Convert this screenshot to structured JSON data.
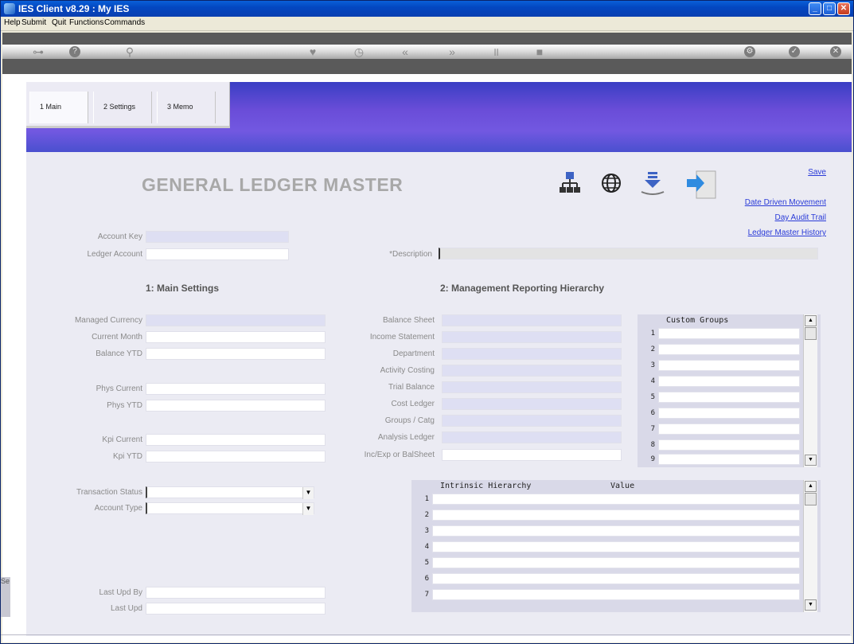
{
  "window": {
    "title": "IES Client v8.29 : My IES",
    "controls": [
      "_",
      "□",
      "✕"
    ]
  },
  "menubar": [
    "Help",
    "Submit",
    "Quit",
    "Functions",
    "Commands"
  ],
  "toolbar": {
    "icons": [
      "key-icon",
      "help-icon",
      "search-icon",
      "heart-icon",
      "clock-icon",
      "back-icon",
      "forward-icon",
      "pause-icon",
      "stop-icon",
      "settings-icon",
      "ok-icon",
      "close-icon"
    ]
  },
  "tabs": [
    {
      "label": "1 Main",
      "active": true
    },
    {
      "label": "2 Settings",
      "active": false
    },
    {
      "label": "3 Memo",
      "active": false
    }
  ],
  "page_title": "GENERAL LEDGER MASTER",
  "actions": {
    "save": "Save",
    "date_driven": "Date Driven Movement",
    "day_audit": "Day Audit Trail",
    "history": "Ledger Master History"
  },
  "header_icons": [
    "hierarchy-icon",
    "globe-icon",
    "download-icon",
    "import-icon"
  ],
  "fields": {
    "account_key": {
      "label": "Account Key",
      "value": ""
    },
    "ledger_account": {
      "label": "Ledger Account",
      "value": ""
    },
    "description": {
      "label": "*Description",
      "value": ""
    }
  },
  "section1": "1: Main Settings",
  "section2": "2: Management Reporting Hierarchy",
  "main_settings": [
    {
      "label": "Managed Currency",
      "value": ""
    },
    {
      "label": "Current Month",
      "value": ""
    },
    {
      "label": "Balance YTD",
      "value": ""
    },
    {
      "label": "Phys Current",
      "value": ""
    },
    {
      "label": "Phys YTD",
      "value": ""
    },
    {
      "label": "Kpi Current",
      "value": ""
    },
    {
      "label": "Kpi YTD",
      "value": ""
    }
  ],
  "hierarchy": [
    {
      "label": "Balance Sheet",
      "value": ""
    },
    {
      "label": "Income Statement",
      "value": ""
    },
    {
      "label": "Department",
      "value": ""
    },
    {
      "label": "Activity Costing",
      "value": ""
    },
    {
      "label": "Trial Balance",
      "value": ""
    },
    {
      "label": "Cost Ledger",
      "value": ""
    },
    {
      "label": "Groups / Catg",
      "value": ""
    },
    {
      "label": "Analysis Ledger",
      "value": ""
    },
    {
      "label": "Inc/Exp or BalSheet",
      "value": ""
    }
  ],
  "transaction_status": {
    "label": "Transaction Status",
    "value": ""
  },
  "account_type": {
    "label": "Account Type",
    "value": ""
  },
  "last_upd_by": {
    "label": "Last Upd By",
    "value": ""
  },
  "last_upd": {
    "label": "Last Upd",
    "value": ""
  },
  "custom_groups": {
    "header": "Custom Groups",
    "rows": [
      "1",
      "2",
      "3",
      "4",
      "5",
      "6",
      "7",
      "8",
      "9"
    ]
  },
  "intrinsic": {
    "header_col1": "Intrinsic Hierarchy",
    "header_col2": "Value",
    "rows": [
      "1",
      "2",
      "3",
      "4",
      "5",
      "6",
      "7"
    ]
  },
  "side_tab": "Se"
}
